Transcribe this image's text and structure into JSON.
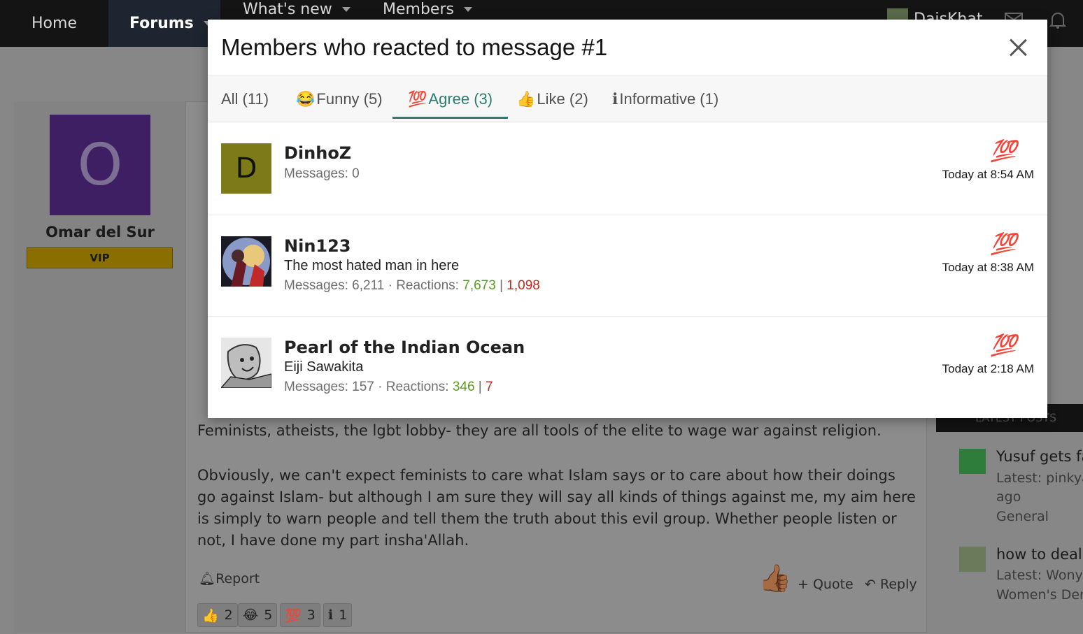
{
  "nav": {
    "home": "Home",
    "forums": "Forums",
    "whats_new": "What's new",
    "members": "Members",
    "username": "DaisKhat"
  },
  "post": {
    "author": {
      "initial": "O",
      "name": "Omar del Sur",
      "badge": "VIP"
    },
    "paragraphs": [
      "Feminists, atheists, the lgbt lobby- they are all tools of the elite to wage war against religion.",
      "Obviously, we can't expect feminists to care what Islam says or to care about how their doings go against Islam- but although I am sure they will say all kinds of things against me, my aim here is simply to warn people and tell them the truth about this evil group. Whether people listen or not, I have done my part insha'Allah."
    ],
    "actions": {
      "report": "Report",
      "quote": "+ Quote",
      "reply": "Reply"
    },
    "reactions_summary": [
      {
        "emoji": "👍",
        "count": "2"
      },
      {
        "emoji": "😂",
        "count": "5"
      },
      {
        "emoji": "💯",
        "count": "3"
      },
      {
        "emoji": "ℹ",
        "count": "1"
      }
    ]
  },
  "sidebar": {
    "latest_posts_label": "LATEST POSTS",
    "items": [
      {
        "title": "Yusuf gets fa",
        "sub1": "Latest: pinkyar",
        "sub2": "ago",
        "sub3": "General"
      },
      {
        "title": "how to deal",
        "sub1": "Latest: Wonylu",
        "sub2": "Women's Den"
      }
    ]
  },
  "modal": {
    "title": "Members who reacted to message #1",
    "tabs": [
      {
        "emoji": "",
        "label": "All (11)",
        "active": false
      },
      {
        "emoji": "😂",
        "label": "Funny (5)",
        "active": false
      },
      {
        "emoji": "💯",
        "label": "Agree (3)",
        "active": true
      },
      {
        "emoji": "👍",
        "label": "Like (2)",
        "active": false
      },
      {
        "emoji": "ℹ",
        "label": "Informative (1)",
        "active": false
      }
    ],
    "rows": [
      {
        "initial": "D",
        "avatar_color": "#7d7a1a",
        "name": "DinhoZ",
        "user_title": "",
        "messages": "Messages: 0",
        "reactions_label": "",
        "reactions_pos": "",
        "reactions_neg": "",
        "reaction": "💯",
        "time": "Today at 8:54 AM"
      },
      {
        "initial": "",
        "avatar_color": "#2c2c3c",
        "name": "Nin123",
        "user_title": "The most hated man in here",
        "messages": "Messages: 6,211",
        "reactions_label": "Reactions:",
        "reactions_pos": "7,673",
        "reactions_neg": "1,098",
        "reaction": "💯",
        "time": "Today at 8:38 AM"
      },
      {
        "initial": "",
        "avatar_color": "#d9d9d9",
        "name": "Pearl of the Indian Ocean",
        "user_title": "Eiji Sawakita",
        "messages": "Messages: 157",
        "reactions_label": "Reactions:",
        "reactions_pos": "346",
        "reactions_neg": "7",
        "reaction": "💯",
        "time": "Today at 2:18 AM"
      }
    ]
  }
}
